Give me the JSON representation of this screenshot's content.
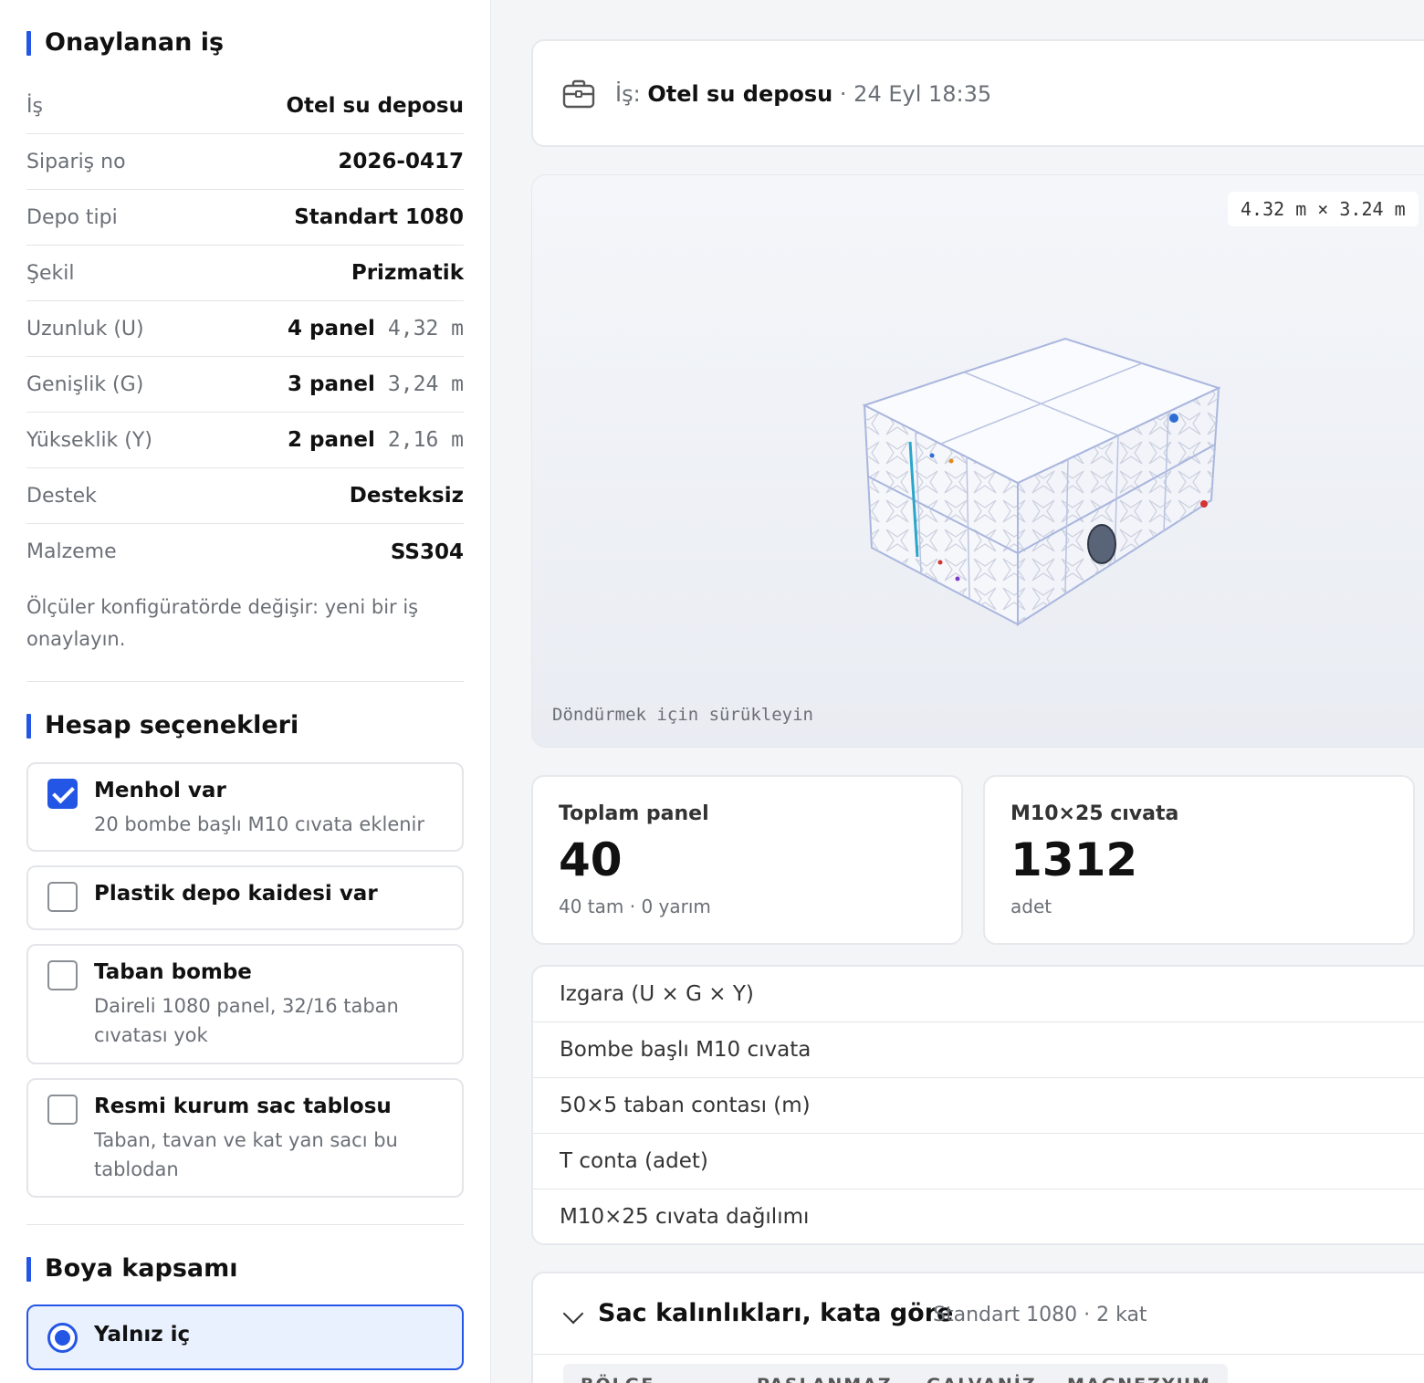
{
  "approved": {
    "title": "Onaylanan iş",
    "rows": [
      {
        "label": "İş",
        "value": "Otel su deposu",
        "mono": ""
      },
      {
        "label": "Sipariş no",
        "value": "2026-0417",
        "mono": ""
      },
      {
        "label": "Depo tipi",
        "value": "Standart 1080",
        "mono": ""
      },
      {
        "label": "Şekil",
        "value": "Prizmatik",
        "mono": ""
      },
      {
        "label": "Uzunluk (U)",
        "value": "4 panel",
        "mono": "4,32 m"
      },
      {
        "label": "Genişlik (G)",
        "value": "3 panel",
        "mono": "3,24 m"
      },
      {
        "label": "Yükseklik (Y)",
        "value": "2 panel",
        "mono": "2,16 m"
      },
      {
        "label": "Destek",
        "value": "Desteksiz",
        "mono": ""
      },
      {
        "label": "Malzeme",
        "value": "SS304",
        "mono": ""
      }
    ],
    "note": "Ölçüler konfigüratörde değişir: yeni bir iş onaylayın."
  },
  "calc_options": {
    "title": "Hesap seçenekleri",
    "items": [
      {
        "label": "Menhol var",
        "desc": "20 bombe başlı M10 cıvata eklenir",
        "checked": true
      },
      {
        "label": "Plastik depo kaidesi var",
        "desc": "",
        "checked": false
      },
      {
        "label": "Taban bombe",
        "desc": "Daireli 1080 panel, 32/16 taban cıvatası yok",
        "checked": false
      },
      {
        "label": "Resmi kurum sac tablosu",
        "desc": "Taban, tavan ve kat yan sacı bu tablodan",
        "checked": false
      }
    ]
  },
  "paint_scope": {
    "title": "Boya kapsamı",
    "selected": "Yalnız iç"
  },
  "job_header": {
    "prefix": "İş:",
    "name": "Otel su deposu",
    "meta": "· 24 Eyl 18:35"
  },
  "viewer": {
    "dimensions": "4.32 m × 3.24 m",
    "hint": "Döndürmek için sürükleyin"
  },
  "stats": [
    {
      "label": "Toplam panel",
      "value": "40",
      "sub": "40 tam · 0 yarım"
    },
    {
      "label": "M10×25 cıvata",
      "value": "1312",
      "sub": "adet"
    }
  ],
  "details": [
    "Izgara (U × G × Y)",
    "Bombe başlı M10 cıvata",
    "50×5 taban contası (m)",
    "T conta (adet)",
    "M10×25 cıvata dağılımı"
  ],
  "thickness": {
    "title": "Sac kalınlıkları, kata göre",
    "sub": "Standart 1080 · 2 kat",
    "columns": [
      "BÖLGE",
      "PASLANMAZ",
      "GALVANİZ",
      "MAGNEZYUM"
    ]
  },
  "colors": {
    "accent": "#2456e6",
    "selected_bg": "#eaf1fe",
    "muted_text": "#6b6f76"
  }
}
